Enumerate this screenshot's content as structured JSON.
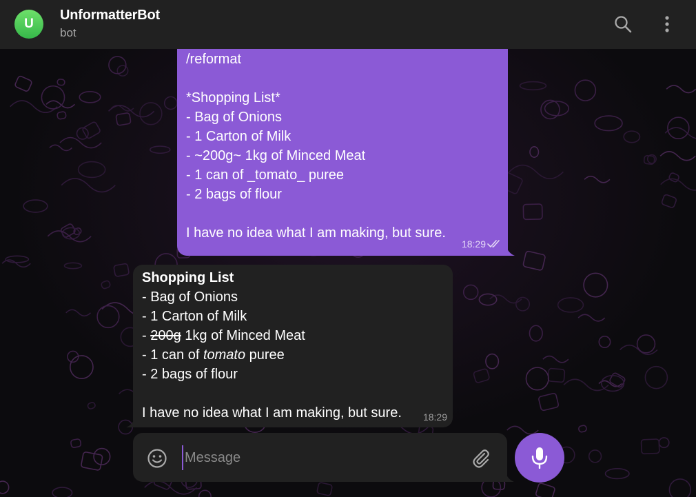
{
  "header": {
    "avatar_letter": "U",
    "title": "UnformatterBot",
    "subtitle": "bot",
    "icons": [
      "search-icon",
      "more-vertical-icon"
    ]
  },
  "messages": {
    "outgoing": {
      "lines": [
        "/reformat",
        "",
        "*Shopping List*",
        "- Bag of Onions",
        "- 1 Carton of Milk",
        "- ~200g~ 1kg of Minced Meat",
        "- 1 can of _tomato_ puree",
        "- 2 bags of flour",
        "",
        "I have no idea what I am making, but sure."
      ],
      "time": "18:29",
      "status_icon": "double-check-icon"
    },
    "incoming": {
      "heading": "Shopping List",
      "item1": "- Bag of Onions",
      "item2": "- 1 Carton of Milk",
      "item3_prefix": "- ",
      "item3_strike": "200g",
      "item3_rest": " 1kg of Minced Meat",
      "item4_prefix": "- 1 can of ",
      "item4_italic": "tomato",
      "item4_rest": " puree",
      "item5": "- 2 bags of flour",
      "closing": "I have no idea what I am making, but sure.",
      "time": "18:29"
    }
  },
  "composer": {
    "placeholder": "Message",
    "icons": [
      "emoji-icon",
      "paperclip-icon",
      "microphone-icon"
    ]
  },
  "colors": {
    "accent": "#8b5ad6",
    "header_bg": "#212121",
    "incoming_bubble": "#212121",
    "avatar": "#43c24f"
  }
}
